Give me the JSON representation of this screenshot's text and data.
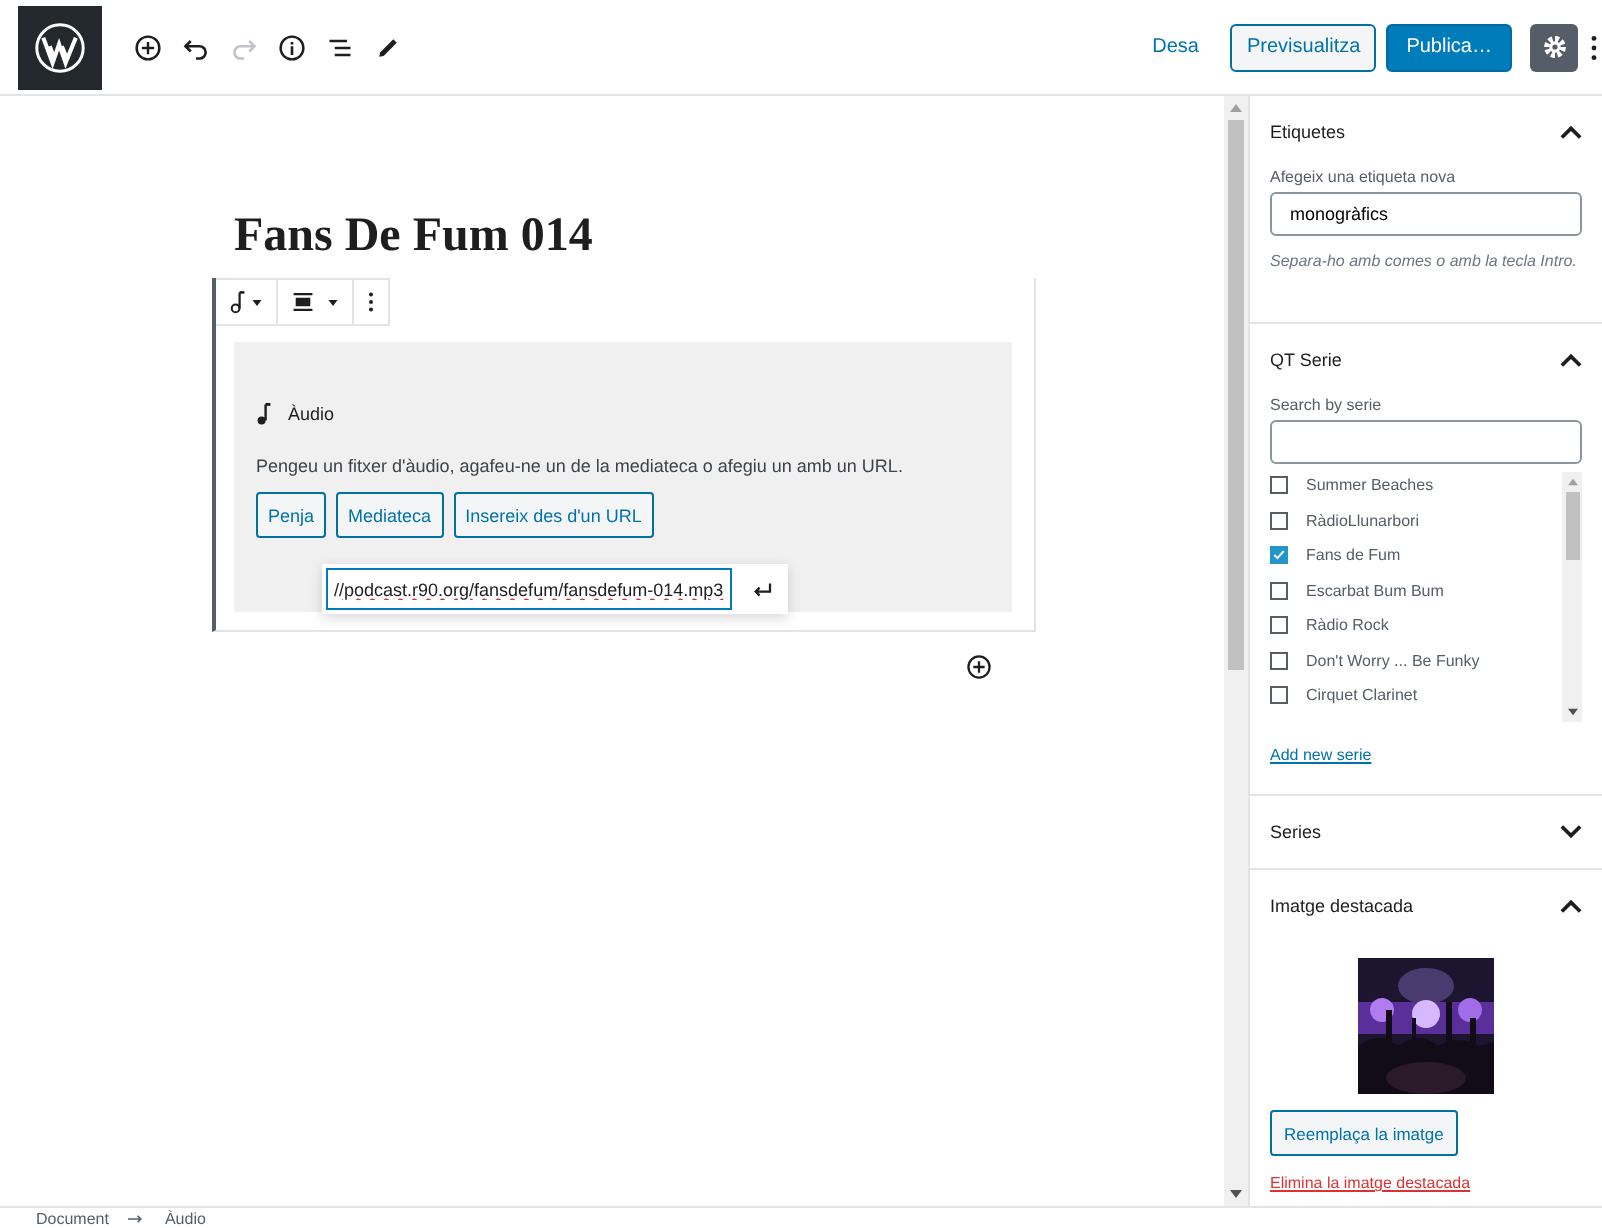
{
  "header": {
    "save": "Desa",
    "preview": "Previsualitza",
    "publish": "Publica…",
    "settings_selected": true
  },
  "editor": {
    "title": "Fans De Fum 014",
    "block": {
      "label": "Àudio",
      "instructions": "Pengeu un fitxer d'àudio, agafeu-ne un de la mediateca o afegiu un amb un URL.",
      "buttons": [
        "Penja",
        "Mediateca",
        "Insereix des d'un URL"
      ],
      "url_value": "//podcast.r90.org/fansdefum/fansdefum-014.mp3"
    }
  },
  "sidebar": {
    "panels": [
      {
        "kind": "tags",
        "title": "Etiquetes",
        "expanded": true,
        "label": "Afegeix una etiqueta nova",
        "value": "monogràfics",
        "help": "Separa-ho amb comes o amb la tecla Intro."
      },
      {
        "kind": "checklist",
        "title": "QT Serie",
        "expanded": true,
        "label": "Search by serie",
        "items": [
          {
            "label": "Summer Beaches",
            "checked": false
          },
          {
            "label": "RàdioLlunarbori",
            "checked": false
          },
          {
            "label": "Fans de Fum",
            "checked": true
          },
          {
            "label": "Escarbat Bum Bum",
            "checked": false
          },
          {
            "label": "Ràdio Rock",
            "checked": false
          },
          {
            "label": "Don't Worry ... Be Funky",
            "checked": false
          },
          {
            "label": "Cirquet Clarinet",
            "checked": false
          }
        ],
        "link": "Add new serie"
      },
      {
        "kind": "plain",
        "title": "Series",
        "expanded": false
      },
      {
        "title": "Imatge destacada",
        "expanded": true,
        "button": "Reemplaça la imatge",
        "link": "Elimina la imatge destacada"
      }
    ]
  },
  "breadcrumbs": [
    "Document",
    "Àudio"
  ]
}
